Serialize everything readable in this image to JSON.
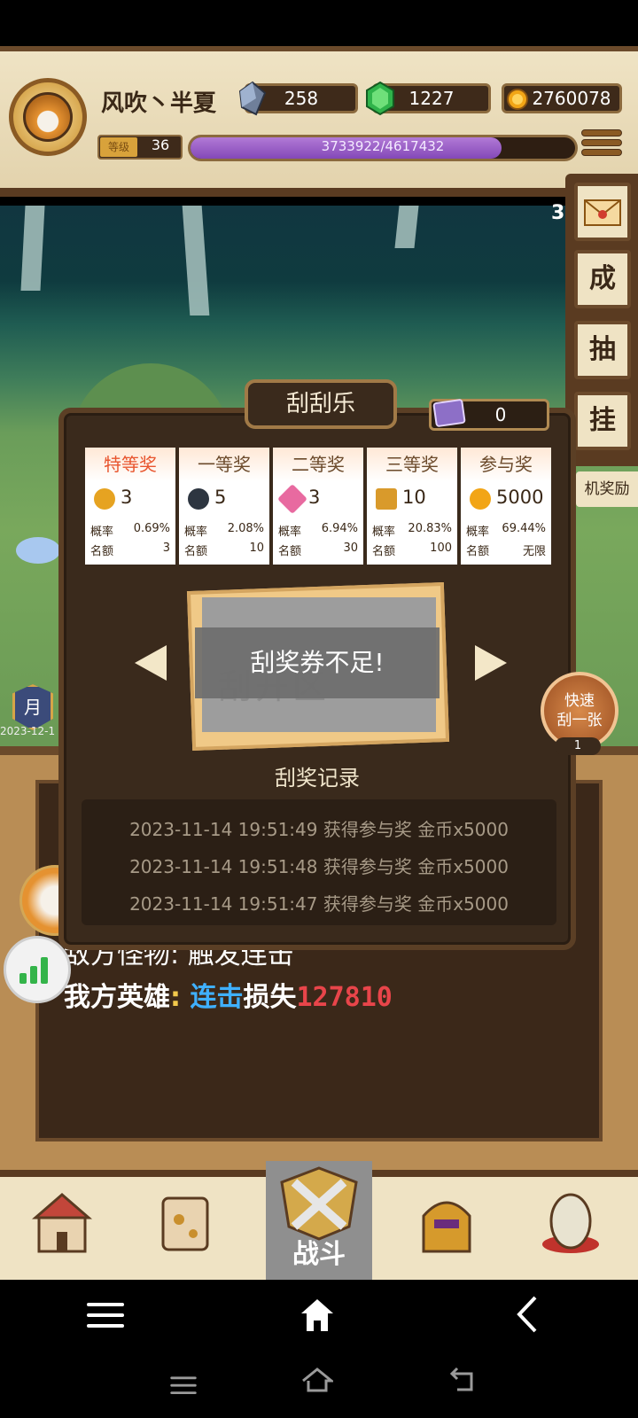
{
  "header": {
    "player_name": "风吹丶半夏",
    "crystal": "258",
    "gem": "1227",
    "gold": "2760078",
    "level_tag": "等级",
    "level": "36",
    "exp_text": "3733922/4617432",
    "exp_progress": 0.8087
  },
  "side": {
    "count": "3",
    "achievement_label": "成",
    "draw_label": "抽",
    "idle_label": "挂",
    "reward_label": "机奖励"
  },
  "popup": {
    "title": "刮刮乐",
    "ticket_count": "0",
    "prize_rate_label": "概率",
    "prize_quota_label": "名额",
    "prizes": [
      {
        "name": "特等奖",
        "count": "3",
        "rate": "0.69%",
        "quota": "3",
        "icon_color": "#e6a321"
      },
      {
        "name": "一等奖",
        "count": "5",
        "rate": "2.08%",
        "quota": "10",
        "icon_color": "#2d3540"
      },
      {
        "name": "二等奖",
        "count": "3",
        "rate": "6.94%",
        "quota": "30",
        "icon_color": "#e86aa0"
      },
      {
        "name": "三等奖",
        "count": "10",
        "rate": "20.83%",
        "quota": "100",
        "icon_color": "#d99a2b"
      },
      {
        "name": "参与奖",
        "count": "5000",
        "rate": "69.44%",
        "quota": "无限",
        "icon_color": "#f2a516"
      }
    ],
    "card_watermark": "刮开区",
    "toast": "刮奖券不足!",
    "quick_btn_line1": "快速",
    "quick_btn_line2": "刮一张",
    "quick_btn_count": "1",
    "record_title": "刮奖记录",
    "records": [
      "2023-11-14 19:51:49 获得参与奖 金币x5000",
      "2023-11-14 19:51:48 获得参与奖 金币x5000",
      "2023-11-14 19:51:47 获得参与奖 金币x5000"
    ]
  },
  "scene": {
    "month_label": "月",
    "month_date": "2023-12-1"
  },
  "log": {
    "line1": "敌方怪物: 触发连击",
    "line2_prefix": "我方英雄",
    "line2_colon": ":",
    "line2_skill": "连击",
    "line2_loss": "损失",
    "line2_value": "127810"
  },
  "nav": {
    "battle_label": "战斗"
  },
  "colors": {
    "accent_purple": "#8348b8",
    "skill_blue": "#3fb0ff",
    "damage_red": "#e8454a",
    "hero_yellow": "#f2c94c"
  }
}
